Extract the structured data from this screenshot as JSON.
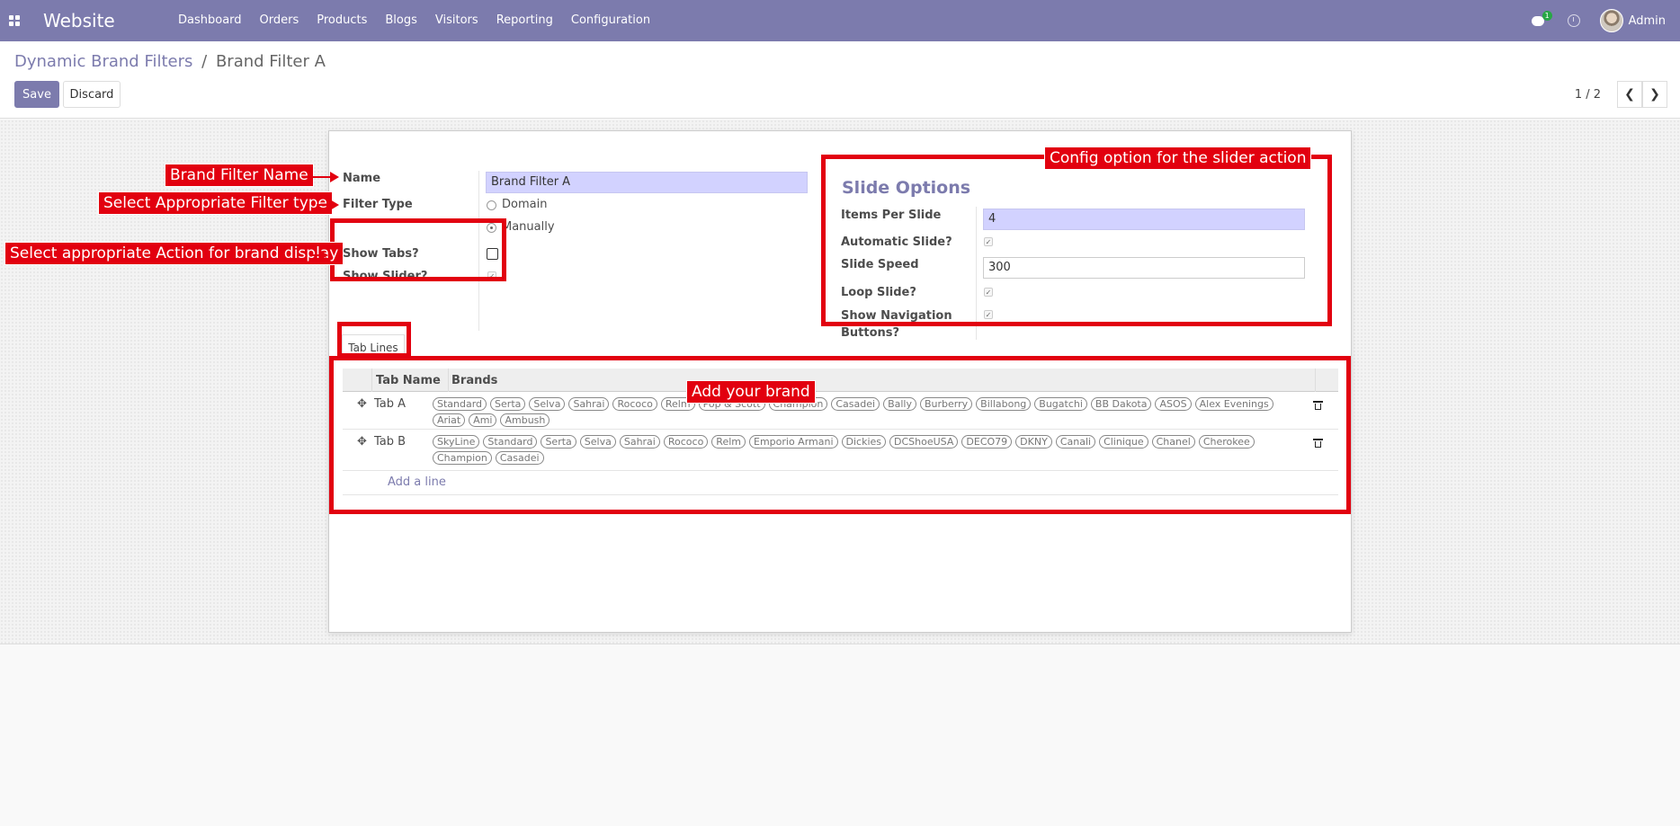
{
  "navbar": {
    "app_name": "Website",
    "menu": [
      "Dashboard",
      "Orders",
      "Products",
      "Blogs",
      "Visitors",
      "Reporting",
      "Configuration"
    ],
    "chat_badge": "1",
    "user_name": "Admin"
  },
  "breadcrumb": {
    "parent": "Dynamic Brand Filters",
    "separator": "/",
    "current": "Brand Filter A"
  },
  "buttons": {
    "save": "Save",
    "discard": "Discard"
  },
  "pager": {
    "text": "1 / 2"
  },
  "form": {
    "name_label": "Name",
    "name_value": "Brand Filter A",
    "filter_type_label": "Filter Type",
    "filter_type_options": [
      "Domain",
      "Manually"
    ],
    "filter_type_selected": "Manually",
    "show_tabs_label": "Show Tabs?",
    "show_tabs_checked": false,
    "show_slider_label": "Show Slider?",
    "show_slider_checked": true
  },
  "slide_options": {
    "title": "Slide Options",
    "items_per_slide_label": "Items Per Slide",
    "items_per_slide_value": "4",
    "automatic_slide_label": "Automatic Slide?",
    "slide_speed_label": "Slide Speed",
    "slide_speed_value": "300",
    "loop_slide_label": "Loop Slide?",
    "show_nav_label_line1": "Show Navigation",
    "show_nav_label_line2": "Buttons?"
  },
  "notebook": {
    "tab_label": "Tab Lines",
    "columns": [
      "Tab Name",
      "Brands"
    ],
    "rows": [
      {
        "name": "Tab A",
        "brands": [
          "Standard",
          "Serta",
          "Selva",
          "Sahrai",
          "Rococo",
          "Relm",
          "Pop & Scott",
          "Champion",
          "Casadei",
          "Bally",
          "Burberry",
          "Billabong",
          "Bugatchi",
          "BB Dakota",
          "ASOS",
          "Alex Evenings",
          "Ariat",
          "Ami",
          "Ambush"
        ]
      },
      {
        "name": "Tab B",
        "brands": [
          "SkyLine",
          "Standard",
          "Serta",
          "Selva",
          "Sahrai",
          "Rococo",
          "Relm",
          "Emporio Armani",
          "Dickies",
          "DCShoeUSA",
          "DECO79",
          "DKNY",
          "Canali",
          "Clinique",
          "Chanel",
          "Cherokee",
          "Champion",
          "Casadei"
        ]
      }
    ],
    "add_line": "Add a line"
  },
  "annotations": {
    "brand_filter_name": "Brand Filter Name",
    "filter_type": "Select Appropriate Filter type",
    "action": "Select appropriate Action for brand display",
    "config": "Config option for the slider action",
    "add_brand": "Add your brand"
  },
  "colors": {
    "navbar": "#7c7bad",
    "primary": "#7c7bad",
    "annotation": "#e2000f",
    "required_field": "#d2d2ff"
  }
}
